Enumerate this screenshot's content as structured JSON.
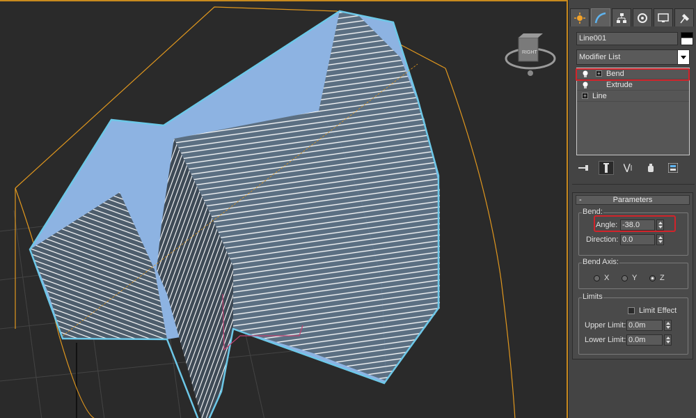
{
  "viewport": {
    "gizmo_label": "RIGHT",
    "colors": {
      "object_fill": "#8db3e2",
      "selection_outline": "#6dc8e8",
      "bounding_box": "#e0971e",
      "grid": "#444444"
    }
  },
  "command_panel": {
    "tabs": [
      {
        "icon": "create-icon"
      },
      {
        "icon": "modify-icon",
        "active": true
      },
      {
        "icon": "hierarchy-icon"
      },
      {
        "icon": "motion-icon"
      },
      {
        "icon": "display-icon"
      },
      {
        "icon": "utilities-icon"
      }
    ],
    "object_name": "Line001",
    "modifier_list": "Modifier List",
    "stack": [
      {
        "label": "Bend",
        "has_bulb": true,
        "has_plus": true
      },
      {
        "label": "Extrude",
        "has_bulb": true,
        "has_plus": false
      },
      {
        "label": "Line",
        "has_bulb": false,
        "has_plus": true
      }
    ],
    "parameters": {
      "header": "Parameters",
      "bend_group": "Bend:",
      "angle_label": "Angle:",
      "angle_value": "-38.0",
      "direction_label": "Direction:",
      "direction_value": "0.0",
      "bend_axis_group": "Bend Axis:",
      "axes": [
        "X",
        "Y",
        "Z"
      ],
      "selected_axis": "Z",
      "limits_group": "Limits",
      "limit_effect_label": "Limit Effect",
      "upper_limit_label": "Upper Limit:",
      "upper_limit_value": "0.0m",
      "lower_limit_label": "Lower Limit:",
      "lower_limit_value": "0.0m"
    },
    "highlight_color": "#d2232a"
  }
}
